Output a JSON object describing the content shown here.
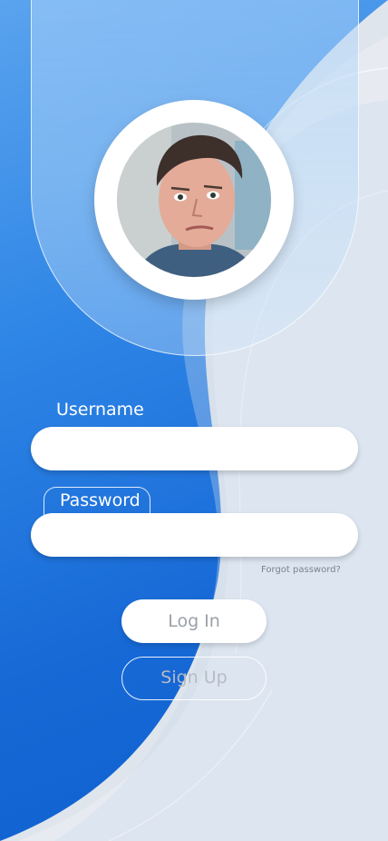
{
  "profile": {
    "avatar_description": "user-photo"
  },
  "form": {
    "username_label": "Username",
    "username_value": "",
    "password_label": "Password",
    "password_value": "",
    "forgot_password": "Forgot password?"
  },
  "buttons": {
    "login": "Log In",
    "signup": "Sign Up"
  },
  "colors": {
    "primary_blue": "#1769d6",
    "light_panel": "#dde4ec",
    "white": "#ffffff"
  }
}
